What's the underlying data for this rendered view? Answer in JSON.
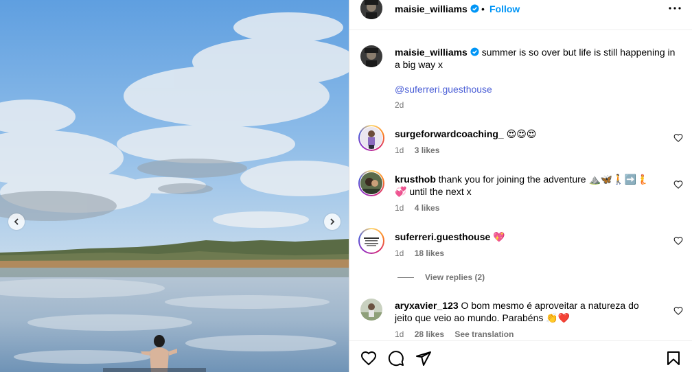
{
  "post": {
    "author": "maisie_williams",
    "follow_label": "Follow",
    "dot": "•",
    "caption": "summer is so over but life is still happening in a big way x",
    "mention": "@suferreri.guesthouse",
    "posted_ago": "2d"
  },
  "comments": [
    {
      "user": "surgeforwardcoaching_",
      "text": "😍😍😍",
      "age": "1d",
      "likes": "3 likes"
    },
    {
      "user": "krusthob",
      "text": "thank you for joining the adventure ⛰️🦋🚶➡️🧜",
      "text_line2": "💞 until the next x",
      "age": "1d",
      "likes": "4 likes"
    },
    {
      "user": "suferreri.guesthouse",
      "text": "💖",
      "age": "1d",
      "likes": "18 likes",
      "view_replies": "View replies (2)"
    },
    {
      "user": "aryxavier_123",
      "text": "O bom mesmo é aproveitar a natureza do",
      "text_line2": "jeito que veio ao mundo. Parabéns 👏❤️",
      "age": "1d",
      "likes": "28 likes",
      "see_translation": "See translation"
    }
  ],
  "colors": {
    "accent": "#0095f6",
    "mention": "#4a5ed6",
    "verified": "#0095f6",
    "meta": "#737373"
  },
  "icons": [
    "more-icon",
    "verified-icon",
    "heart-icon",
    "comment-icon",
    "share-icon",
    "bookmark-icon",
    "chevron-left-icon",
    "chevron-right-icon"
  ]
}
